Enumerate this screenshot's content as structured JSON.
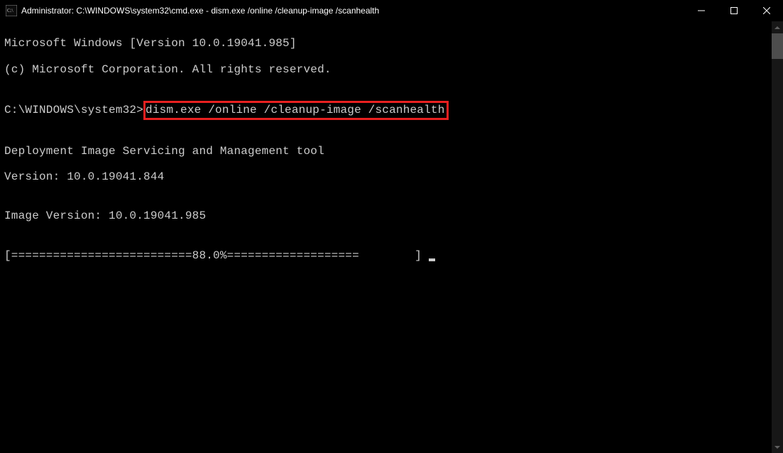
{
  "titlebar": {
    "text": "Administrator: C:\\WINDOWS\\system32\\cmd.exe - dism.exe  /online /cleanup-image /scanhealth"
  },
  "terminal": {
    "line1": "Microsoft Windows [Version 10.0.19041.985]",
    "line2": "(c) Microsoft Corporation. All rights reserved.",
    "blank1": "",
    "prompt_prefix": "C:\\WINDOWS\\system32>",
    "command": "dism.exe /online /cleanup-image /scanhealth",
    "blank2": "",
    "line3": "Deployment Image Servicing and Management tool",
    "line4": "Version: 10.0.19041.844",
    "blank3": "",
    "line5": "Image Version: 10.0.19041.985",
    "blank4": "",
    "progress": "[==========================88.0%===================        ] "
  }
}
